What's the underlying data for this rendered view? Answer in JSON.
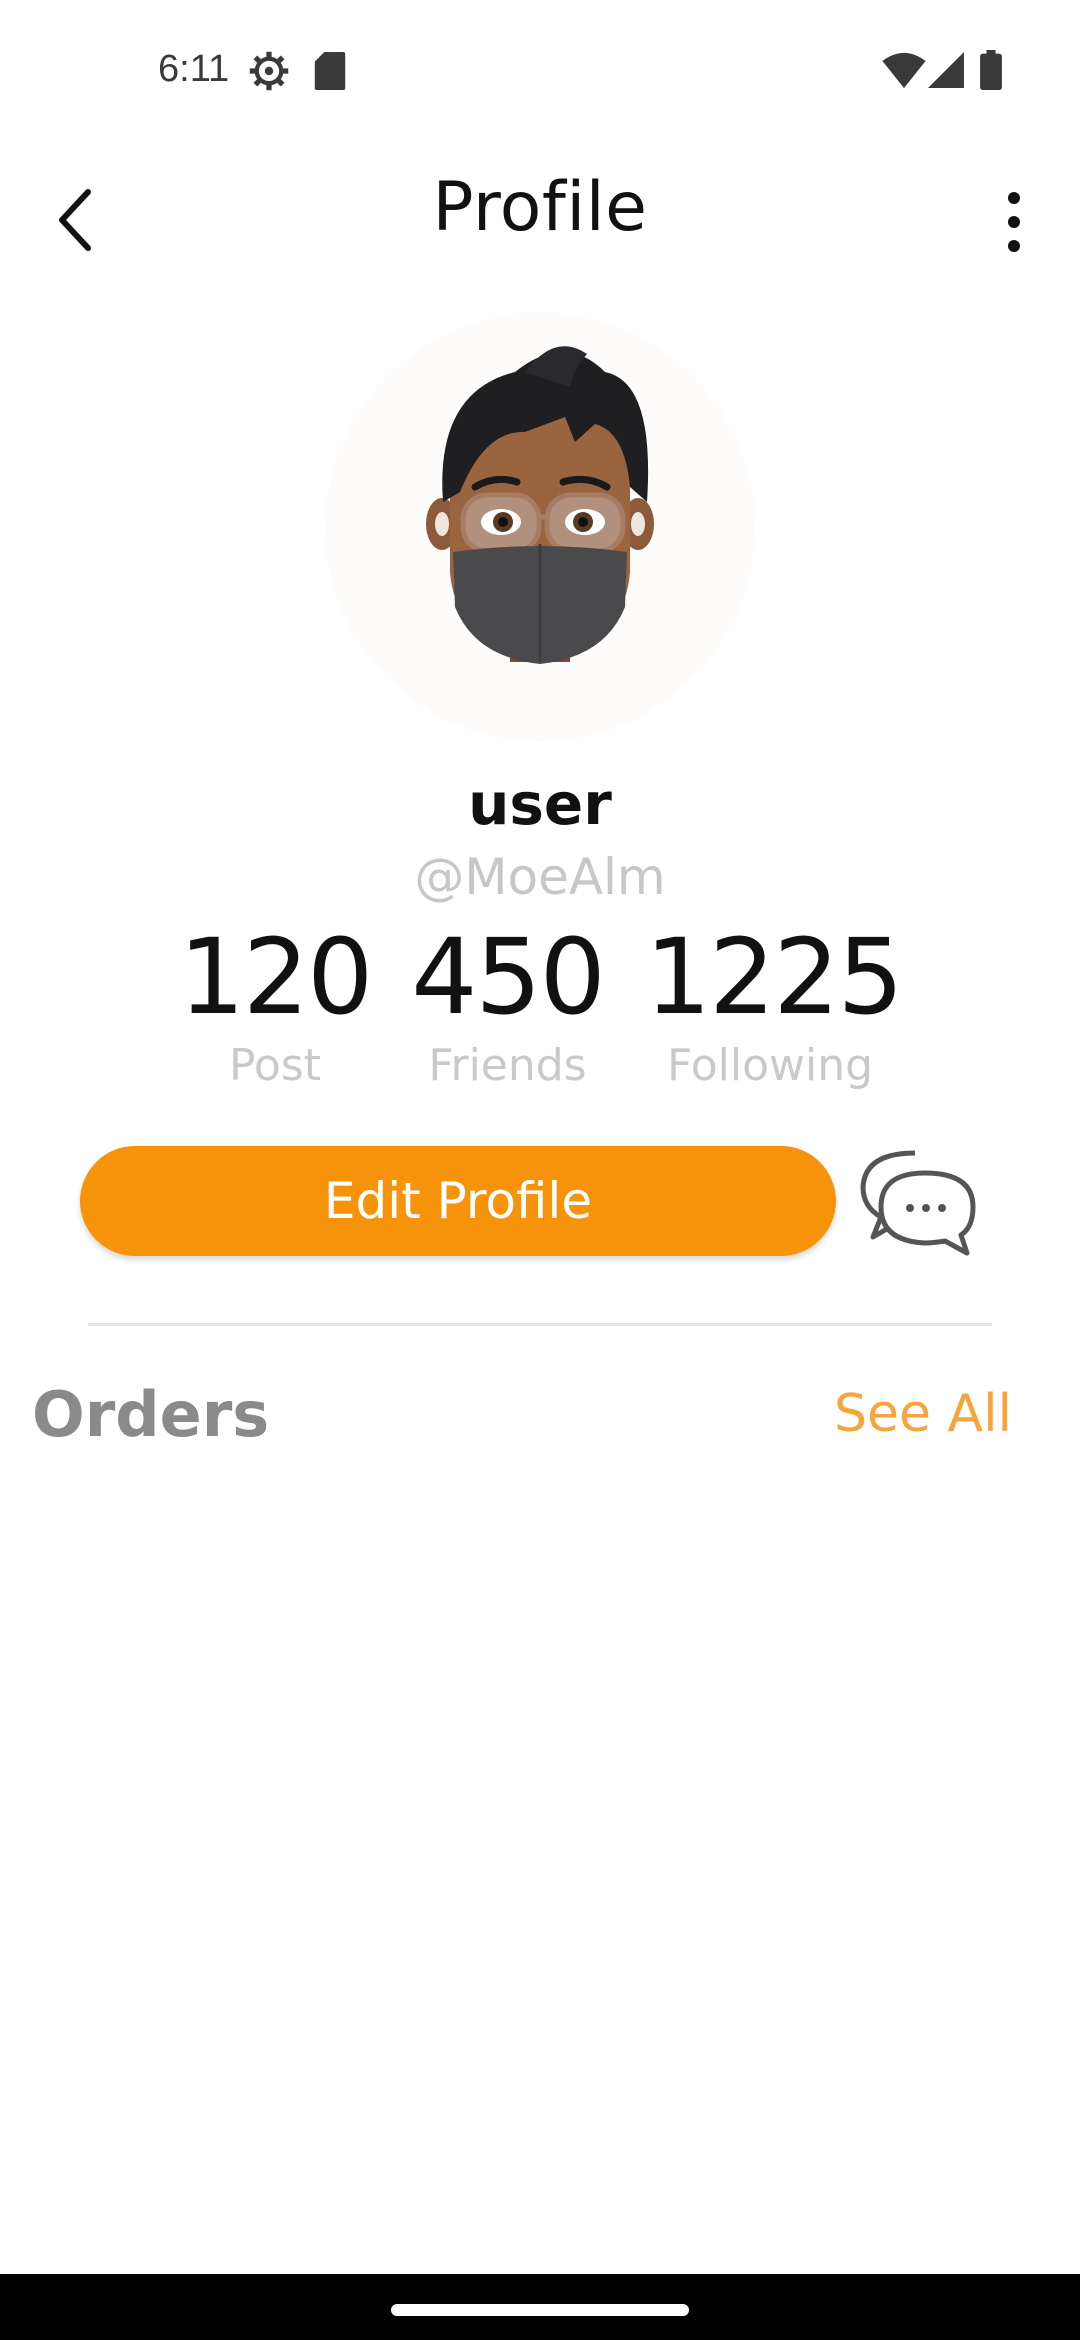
{
  "status_bar": {
    "time": "6:11",
    "icons": [
      "gear-icon",
      "sd-card-icon",
      "wifi-icon",
      "signal-icon",
      "battery-icon"
    ]
  },
  "app_bar": {
    "title": "Profile",
    "back_icon": "chevron-left-icon",
    "menu_icon": "more-vertical-icon"
  },
  "profile": {
    "avatar_icon": "memoji-avatar",
    "username": "user",
    "handle": "@MoeAlm"
  },
  "stats": [
    {
      "value": "120",
      "label": "Post"
    },
    {
      "value": "450",
      "label": "Friends"
    },
    {
      "value": "1225",
      "label": "Following"
    }
  ],
  "actions": {
    "edit_profile_label": "Edit Profile",
    "chat_icon": "chat-bubbles-icon"
  },
  "orders": {
    "title": "Orders",
    "see_all_label": "See All"
  },
  "colors": {
    "accent": "#f7930b",
    "see_all": "#f7a43a",
    "muted_text": "#c9c9c9",
    "section_title": "#8a8a8a"
  }
}
